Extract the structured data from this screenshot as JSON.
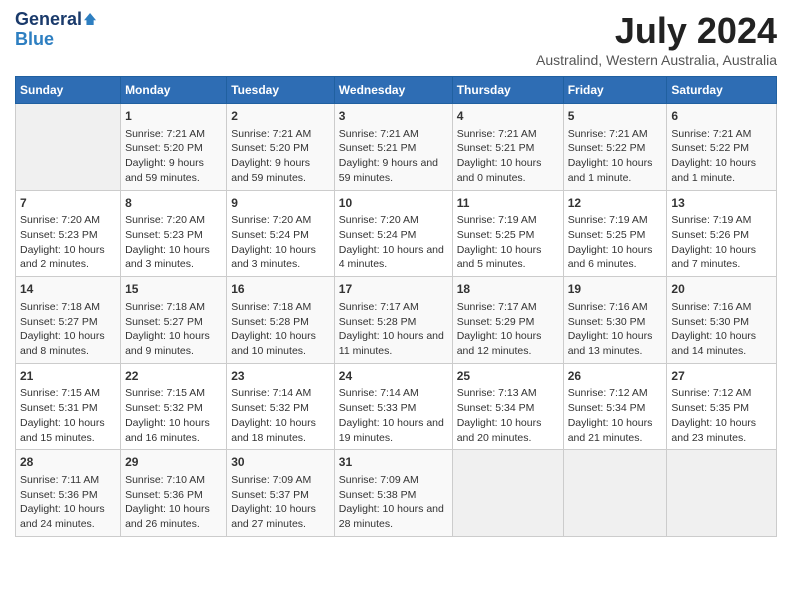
{
  "header": {
    "logo_line1": "General",
    "logo_line2": "Blue",
    "month": "July 2024",
    "location": "Australind, Western Australia, Australia"
  },
  "days_of_week": [
    "Sunday",
    "Monday",
    "Tuesday",
    "Wednesday",
    "Thursday",
    "Friday",
    "Saturday"
  ],
  "weeks": [
    [
      {
        "day": "",
        "empty": true
      },
      {
        "day": "1",
        "sunrise": "7:21 AM",
        "sunset": "5:20 PM",
        "daylight": "9 hours and 59 minutes."
      },
      {
        "day": "2",
        "sunrise": "7:21 AM",
        "sunset": "5:20 PM",
        "daylight": "9 hours and 59 minutes."
      },
      {
        "day": "3",
        "sunrise": "7:21 AM",
        "sunset": "5:21 PM",
        "daylight": "9 hours and 59 minutes."
      },
      {
        "day": "4",
        "sunrise": "7:21 AM",
        "sunset": "5:21 PM",
        "daylight": "10 hours and 0 minutes."
      },
      {
        "day": "5",
        "sunrise": "7:21 AM",
        "sunset": "5:22 PM",
        "daylight": "10 hours and 1 minute."
      },
      {
        "day": "6",
        "sunrise": "7:21 AM",
        "sunset": "5:22 PM",
        "daylight": "10 hours and 1 minute."
      }
    ],
    [
      {
        "day": "7",
        "sunrise": "7:20 AM",
        "sunset": "5:23 PM",
        "daylight": "10 hours and 2 minutes."
      },
      {
        "day": "8",
        "sunrise": "7:20 AM",
        "sunset": "5:23 PM",
        "daylight": "10 hours and 3 minutes."
      },
      {
        "day": "9",
        "sunrise": "7:20 AM",
        "sunset": "5:24 PM",
        "daylight": "10 hours and 3 minutes."
      },
      {
        "day": "10",
        "sunrise": "7:20 AM",
        "sunset": "5:24 PM",
        "daylight": "10 hours and 4 minutes."
      },
      {
        "day": "11",
        "sunrise": "7:19 AM",
        "sunset": "5:25 PM",
        "daylight": "10 hours and 5 minutes."
      },
      {
        "day": "12",
        "sunrise": "7:19 AM",
        "sunset": "5:25 PM",
        "daylight": "10 hours and 6 minutes."
      },
      {
        "day": "13",
        "sunrise": "7:19 AM",
        "sunset": "5:26 PM",
        "daylight": "10 hours and 7 minutes."
      }
    ],
    [
      {
        "day": "14",
        "sunrise": "7:18 AM",
        "sunset": "5:27 PM",
        "daylight": "10 hours and 8 minutes."
      },
      {
        "day": "15",
        "sunrise": "7:18 AM",
        "sunset": "5:27 PM",
        "daylight": "10 hours and 9 minutes."
      },
      {
        "day": "16",
        "sunrise": "7:18 AM",
        "sunset": "5:28 PM",
        "daylight": "10 hours and 10 minutes."
      },
      {
        "day": "17",
        "sunrise": "7:17 AM",
        "sunset": "5:28 PM",
        "daylight": "10 hours and 11 minutes."
      },
      {
        "day": "18",
        "sunrise": "7:17 AM",
        "sunset": "5:29 PM",
        "daylight": "10 hours and 12 minutes."
      },
      {
        "day": "19",
        "sunrise": "7:16 AM",
        "sunset": "5:30 PM",
        "daylight": "10 hours and 13 minutes."
      },
      {
        "day": "20",
        "sunrise": "7:16 AM",
        "sunset": "5:30 PM",
        "daylight": "10 hours and 14 minutes."
      }
    ],
    [
      {
        "day": "21",
        "sunrise": "7:15 AM",
        "sunset": "5:31 PM",
        "daylight": "10 hours and 15 minutes."
      },
      {
        "day": "22",
        "sunrise": "7:15 AM",
        "sunset": "5:32 PM",
        "daylight": "10 hours and 16 minutes."
      },
      {
        "day": "23",
        "sunrise": "7:14 AM",
        "sunset": "5:32 PM",
        "daylight": "10 hours and 18 minutes."
      },
      {
        "day": "24",
        "sunrise": "7:14 AM",
        "sunset": "5:33 PM",
        "daylight": "10 hours and 19 minutes."
      },
      {
        "day": "25",
        "sunrise": "7:13 AM",
        "sunset": "5:34 PM",
        "daylight": "10 hours and 20 minutes."
      },
      {
        "day": "26",
        "sunrise": "7:12 AM",
        "sunset": "5:34 PM",
        "daylight": "10 hours and 21 minutes."
      },
      {
        "day": "27",
        "sunrise": "7:12 AM",
        "sunset": "5:35 PM",
        "daylight": "10 hours and 23 minutes."
      }
    ],
    [
      {
        "day": "28",
        "sunrise": "7:11 AM",
        "sunset": "5:36 PM",
        "daylight": "10 hours and 24 minutes."
      },
      {
        "day": "29",
        "sunrise": "7:10 AM",
        "sunset": "5:36 PM",
        "daylight": "10 hours and 26 minutes."
      },
      {
        "day": "30",
        "sunrise": "7:09 AM",
        "sunset": "5:37 PM",
        "daylight": "10 hours and 27 minutes."
      },
      {
        "day": "31",
        "sunrise": "7:09 AM",
        "sunset": "5:38 PM",
        "daylight": "10 hours and 28 minutes."
      },
      {
        "day": "",
        "empty": true
      },
      {
        "day": "",
        "empty": true
      },
      {
        "day": "",
        "empty": true
      }
    ]
  ]
}
